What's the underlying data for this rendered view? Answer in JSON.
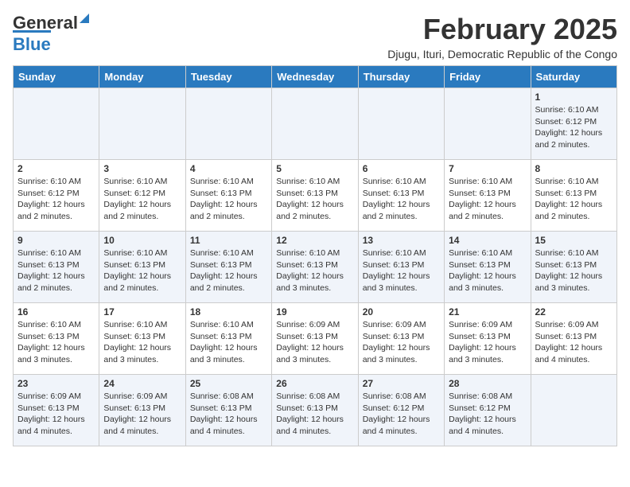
{
  "header": {
    "logo_line1": "General",
    "logo_line2": "Blue",
    "month": "February 2025",
    "location": "Djugu, Ituri, Democratic Republic of the Congo"
  },
  "weekdays": [
    "Sunday",
    "Monday",
    "Tuesday",
    "Wednesday",
    "Thursday",
    "Friday",
    "Saturday"
  ],
  "weeks": [
    [
      {
        "day": "",
        "info": ""
      },
      {
        "day": "",
        "info": ""
      },
      {
        "day": "",
        "info": ""
      },
      {
        "day": "",
        "info": ""
      },
      {
        "day": "",
        "info": ""
      },
      {
        "day": "",
        "info": ""
      },
      {
        "day": "1",
        "info": "Sunrise: 6:10 AM\nSunset: 6:12 PM\nDaylight: 12 hours and 2 minutes."
      }
    ],
    [
      {
        "day": "2",
        "info": "Sunrise: 6:10 AM\nSunset: 6:12 PM\nDaylight: 12 hours and 2 minutes."
      },
      {
        "day": "3",
        "info": "Sunrise: 6:10 AM\nSunset: 6:12 PM\nDaylight: 12 hours and 2 minutes."
      },
      {
        "day": "4",
        "info": "Sunrise: 6:10 AM\nSunset: 6:13 PM\nDaylight: 12 hours and 2 minutes."
      },
      {
        "day": "5",
        "info": "Sunrise: 6:10 AM\nSunset: 6:13 PM\nDaylight: 12 hours and 2 minutes."
      },
      {
        "day": "6",
        "info": "Sunrise: 6:10 AM\nSunset: 6:13 PM\nDaylight: 12 hours and 2 minutes."
      },
      {
        "day": "7",
        "info": "Sunrise: 6:10 AM\nSunset: 6:13 PM\nDaylight: 12 hours and 2 minutes."
      },
      {
        "day": "8",
        "info": "Sunrise: 6:10 AM\nSunset: 6:13 PM\nDaylight: 12 hours and 2 minutes."
      }
    ],
    [
      {
        "day": "9",
        "info": "Sunrise: 6:10 AM\nSunset: 6:13 PM\nDaylight: 12 hours and 2 minutes."
      },
      {
        "day": "10",
        "info": "Sunrise: 6:10 AM\nSunset: 6:13 PM\nDaylight: 12 hours and 2 minutes."
      },
      {
        "day": "11",
        "info": "Sunrise: 6:10 AM\nSunset: 6:13 PM\nDaylight: 12 hours and 2 minutes."
      },
      {
        "day": "12",
        "info": "Sunrise: 6:10 AM\nSunset: 6:13 PM\nDaylight: 12 hours and 3 minutes."
      },
      {
        "day": "13",
        "info": "Sunrise: 6:10 AM\nSunset: 6:13 PM\nDaylight: 12 hours and 3 minutes."
      },
      {
        "day": "14",
        "info": "Sunrise: 6:10 AM\nSunset: 6:13 PM\nDaylight: 12 hours and 3 minutes."
      },
      {
        "day": "15",
        "info": "Sunrise: 6:10 AM\nSunset: 6:13 PM\nDaylight: 12 hours and 3 minutes."
      }
    ],
    [
      {
        "day": "16",
        "info": "Sunrise: 6:10 AM\nSunset: 6:13 PM\nDaylight: 12 hours and 3 minutes."
      },
      {
        "day": "17",
        "info": "Sunrise: 6:10 AM\nSunset: 6:13 PM\nDaylight: 12 hours and 3 minutes."
      },
      {
        "day": "18",
        "info": "Sunrise: 6:10 AM\nSunset: 6:13 PM\nDaylight: 12 hours and 3 minutes."
      },
      {
        "day": "19",
        "info": "Sunrise: 6:09 AM\nSunset: 6:13 PM\nDaylight: 12 hours and 3 minutes."
      },
      {
        "day": "20",
        "info": "Sunrise: 6:09 AM\nSunset: 6:13 PM\nDaylight: 12 hours and 3 minutes."
      },
      {
        "day": "21",
        "info": "Sunrise: 6:09 AM\nSunset: 6:13 PM\nDaylight: 12 hours and 3 minutes."
      },
      {
        "day": "22",
        "info": "Sunrise: 6:09 AM\nSunset: 6:13 PM\nDaylight: 12 hours and 4 minutes."
      }
    ],
    [
      {
        "day": "23",
        "info": "Sunrise: 6:09 AM\nSunset: 6:13 PM\nDaylight: 12 hours and 4 minutes."
      },
      {
        "day": "24",
        "info": "Sunrise: 6:09 AM\nSunset: 6:13 PM\nDaylight: 12 hours and 4 minutes."
      },
      {
        "day": "25",
        "info": "Sunrise: 6:08 AM\nSunset: 6:13 PM\nDaylight: 12 hours and 4 minutes."
      },
      {
        "day": "26",
        "info": "Sunrise: 6:08 AM\nSunset: 6:13 PM\nDaylight: 12 hours and 4 minutes."
      },
      {
        "day": "27",
        "info": "Sunrise: 6:08 AM\nSunset: 6:12 PM\nDaylight: 12 hours and 4 minutes."
      },
      {
        "day": "28",
        "info": "Sunrise: 6:08 AM\nSunset: 6:12 PM\nDaylight: 12 hours and 4 minutes."
      },
      {
        "day": "",
        "info": ""
      }
    ]
  ]
}
